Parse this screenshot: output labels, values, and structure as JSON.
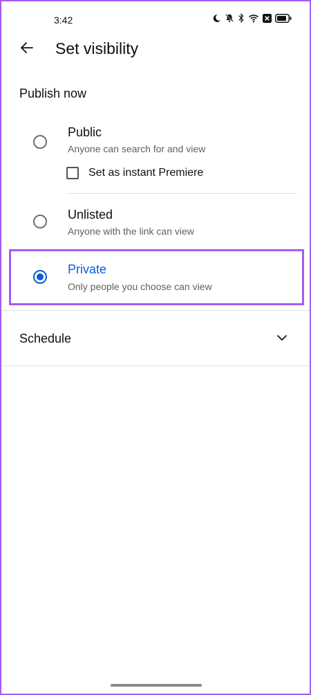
{
  "status_bar": {
    "time": "3:42",
    "icons": [
      "moon-icon",
      "mute-icon",
      "bluetooth-icon",
      "wifi-icon",
      "close-box-icon",
      "battery-icon"
    ]
  },
  "header": {
    "back_icon": "arrow-left-icon",
    "title": "Set visibility"
  },
  "publish_now": {
    "label": "Publish now",
    "options": [
      {
        "label": "Public",
        "description": "Anyone can search for and view",
        "selected": false
      },
      {
        "label": "Unlisted",
        "description": "Anyone with the link can view",
        "selected": false
      },
      {
        "label": "Private",
        "description": "Only people you choose can view",
        "selected": true
      }
    ],
    "premiere_checkbox": {
      "label": "Set as instant Premiere",
      "checked": false
    }
  },
  "schedule": {
    "label": "Schedule",
    "icon": "chevron-down-icon"
  },
  "colors": {
    "accent": "#065fd4",
    "highlight": "#a35cf0",
    "text_primary": "#0f0f0f",
    "text_secondary": "#606060",
    "divider": "#e0e0e0"
  }
}
